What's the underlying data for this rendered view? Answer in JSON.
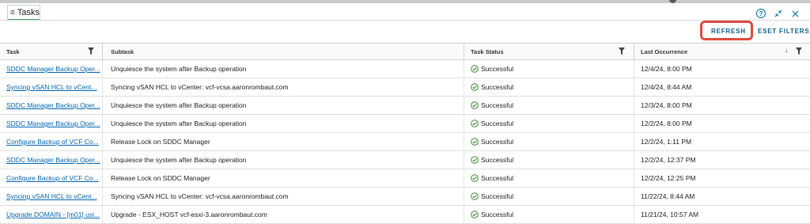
{
  "window": {
    "tab_label": "Tasks"
  },
  "toolbar": {
    "refresh_label": "REFRESH",
    "reset_label": "ESET FILTERS"
  },
  "columns": {
    "task": "Task",
    "subtask": "Subtask",
    "status": "Task Status",
    "occurrence": "Last Occurrence"
  },
  "rows": [
    {
      "task": "SDDC Manager Backup Oper...",
      "subtask": "Unquiesce the system after Backup operation",
      "status": "Successful",
      "occurrence": "12/4/24, 8:00 PM"
    },
    {
      "task": "Syncing vSAN HCL to vCent...",
      "subtask": "Syncing vSAN HCL to vCenter: vcf-vcsa.aaronrombaut.com",
      "status": "Successful",
      "occurrence": "12/4/24, 8:44 AM"
    },
    {
      "task": "SDDC Manager Backup Oper...",
      "subtask": "Unquiesce the system after Backup operation",
      "status": "Successful",
      "occurrence": "12/3/24, 8:00 PM"
    },
    {
      "task": "SDDC Manager Backup Oper...",
      "subtask": "Unquiesce the system after Backup operation",
      "status": "Successful",
      "occurrence": "12/2/24, 8:00 PM"
    },
    {
      "task": "Configure Backup of VCF Co...",
      "subtask": "Release Lock on SDDC Manager",
      "status": "Successful",
      "occurrence": "12/2/24, 1:11 PM"
    },
    {
      "task": "SDDC Manager Backup Oper...",
      "subtask": "Unquiesce the system after Backup operation",
      "status": "Successful",
      "occurrence": "12/2/24, 12:37 PM"
    },
    {
      "task": "Configure Backup of VCF Co...",
      "subtask": "Release Lock on SDDC Manager",
      "status": "Successful",
      "occurrence": "12/2/24, 12:25 PM"
    },
    {
      "task": "Syncing vSAN HCL to vCent...",
      "subtask": "Syncing vSAN HCL to vCenter: vcf-vcsa.aaronrombaut.com",
      "status": "Successful",
      "occurrence": "11/22/24, 8:44 AM"
    },
    {
      "task": "Upgrade DOMAIN - [m01] usi...",
      "subtask": "Upgrade - ESX_HOST vcf-esxi-3.aaronrombaut.com",
      "status": "Successful",
      "occurrence": "11/21/24, 10:57 AM"
    }
  ],
  "icons": {
    "tab": "clipboard-icon",
    "status": "check-circle-icon",
    "help": "help-icon",
    "collapse": "collapse-icon",
    "close": "close-icon"
  },
  "colors": {
    "link": "#0064b4",
    "success": "#3c8a32",
    "highlight": "#e04a3f",
    "action": "#0b5c89"
  }
}
